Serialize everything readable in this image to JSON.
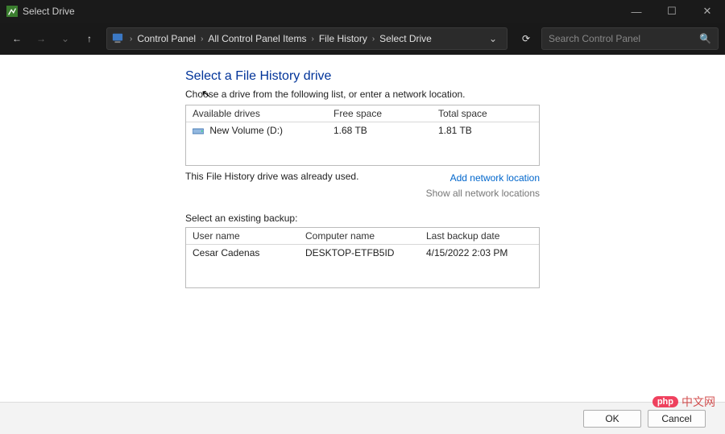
{
  "window": {
    "title": "Select Drive",
    "min": "—",
    "max": "☐",
    "close": "✕"
  },
  "nav": {
    "back": "←",
    "forward": "→",
    "recent": "⌄",
    "up": "↑",
    "refresh": "⟳",
    "dropdown": "⌄"
  },
  "breadcrumbs": {
    "root_icon": "🛠",
    "sep": "›",
    "items": [
      "Control Panel",
      "All Control Panel Items",
      "File History",
      "Select Drive"
    ]
  },
  "search": {
    "placeholder": "Search Control Panel",
    "icon": "🔍"
  },
  "page": {
    "heading": "Select a File History drive",
    "instruction": "Choose a drive from the following list, or enter a network location.",
    "drives_header": {
      "c1": "Available drives",
      "c2": "Free space",
      "c3": "Total space"
    },
    "drives": [
      {
        "name": "New Volume (D:)",
        "free": "1.68 TB",
        "total": "1.81 TB"
      }
    ],
    "status": "This File History drive was already used.",
    "link_add": "Add network location",
    "link_show": "Show all network locations",
    "backup_heading": "Select an existing backup:",
    "backup_header": {
      "b1": "User name",
      "b2": "Computer name",
      "b3": "Last backup date"
    },
    "backups": [
      {
        "user": "Cesar Cadenas",
        "computer": "DESKTOP-ETFB5ID",
        "date": "4/15/2022 2:03 PM"
      }
    ]
  },
  "buttons": {
    "ok": "OK",
    "cancel": "Cancel"
  },
  "watermark": {
    "badge": "php",
    "text": "中文网"
  }
}
